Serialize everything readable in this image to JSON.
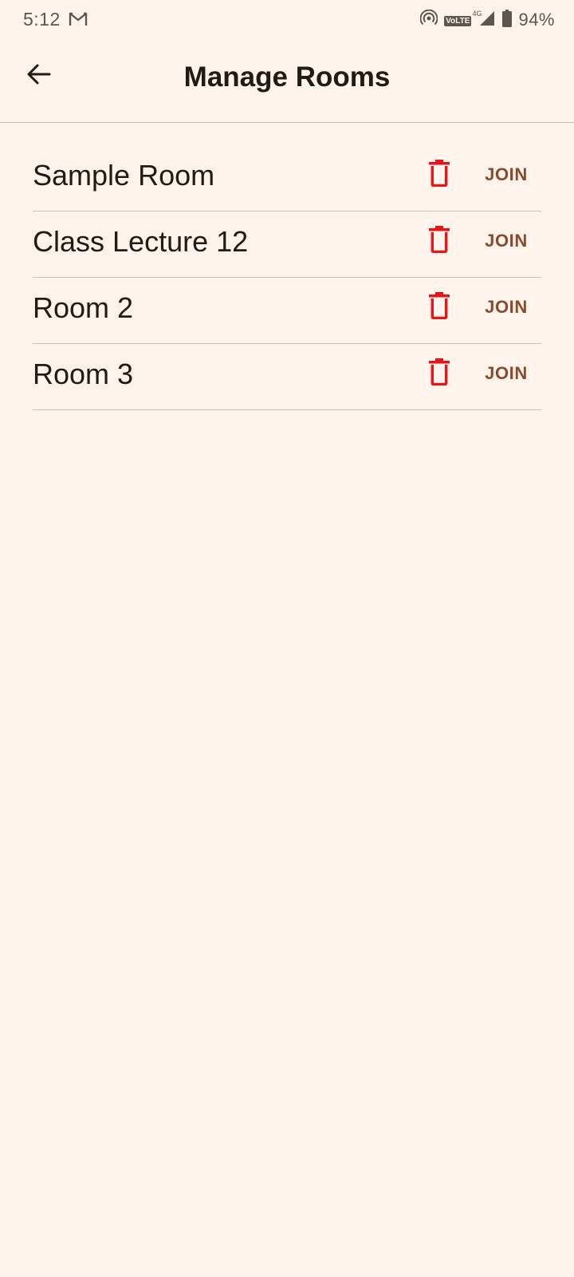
{
  "status_bar": {
    "time": "5:12",
    "network_label": "VoLTE",
    "network_type": "4G",
    "battery": "94%",
    "icons": [
      "gmail-icon",
      "hotspot-icon",
      "signal-icon",
      "battery-icon"
    ]
  },
  "app_bar": {
    "title": "Manage Rooms",
    "back_icon": "arrow-left-icon"
  },
  "rooms": [
    {
      "name": "Sample Room",
      "action": "JOIN"
    },
    {
      "name": "Class Lecture 12",
      "action": "JOIN"
    },
    {
      "name": "Room 2",
      "action": "JOIN"
    },
    {
      "name": "Room 3",
      "action": "JOIN"
    }
  ],
  "colors": {
    "background": "#FFF4EC",
    "delete_icon": "#E8141A",
    "join_text": "#8A4A2E",
    "divider": "#CDC0B8",
    "text_primary": "#231A14"
  }
}
